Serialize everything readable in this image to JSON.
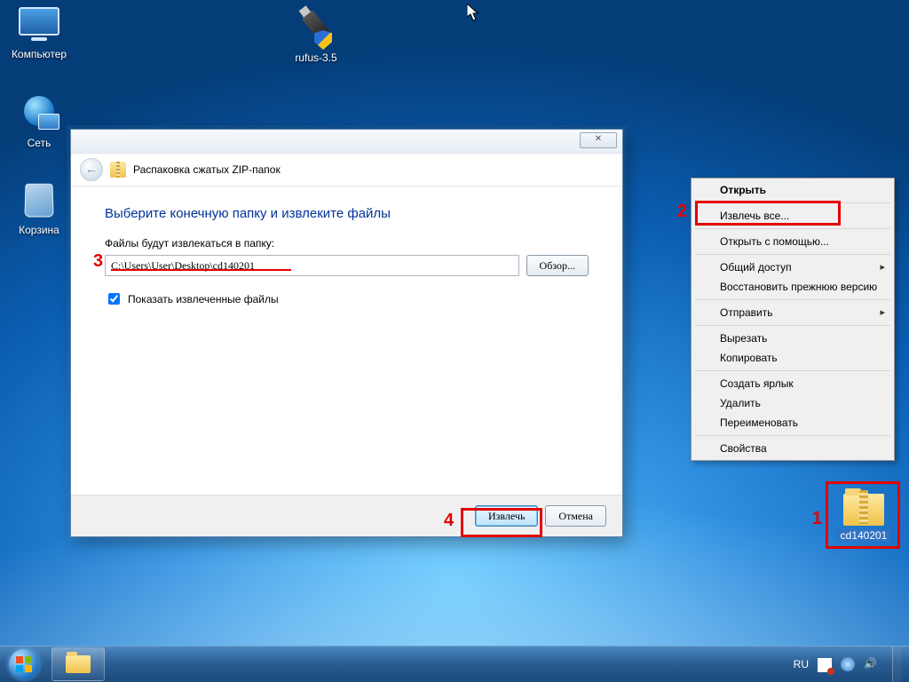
{
  "desktop_icons": {
    "computer": "Компьютер",
    "network": "Сеть",
    "recycle": "Корзина",
    "rufus": "rufus-3.5"
  },
  "zipfile": {
    "label": "cd140201"
  },
  "context_menu": {
    "open": "Открыть",
    "extract_all": "Извлечь все...",
    "open_with": "Открыть с помощью...",
    "sharing": "Общий доступ",
    "restore_prev": "Восстановить прежнюю версию",
    "send_to": "Отправить",
    "cut": "Вырезать",
    "copy": "Копировать",
    "create_shortcut": "Создать ярлык",
    "delete": "Удалить",
    "rename": "Переименовать",
    "properties": "Свойства"
  },
  "dialog": {
    "title": "Распаковка сжатых ZIP-папок",
    "heading": "Выберите конечную папку и извлеките файлы",
    "dest_label": "Файлы будут извлекаться в папку:",
    "path": "C:\\Users\\User\\Desktop\\cd140201",
    "browse": "Обзор...",
    "show_extracted": "Показать извлеченные файлы",
    "extract": "Извлечь",
    "cancel": "Отмена",
    "close_glyph": "✕"
  },
  "annotations": {
    "n1": "1",
    "n2": "2",
    "n3": "3",
    "n4": "4"
  },
  "taskbar": {
    "lang": "RU"
  }
}
